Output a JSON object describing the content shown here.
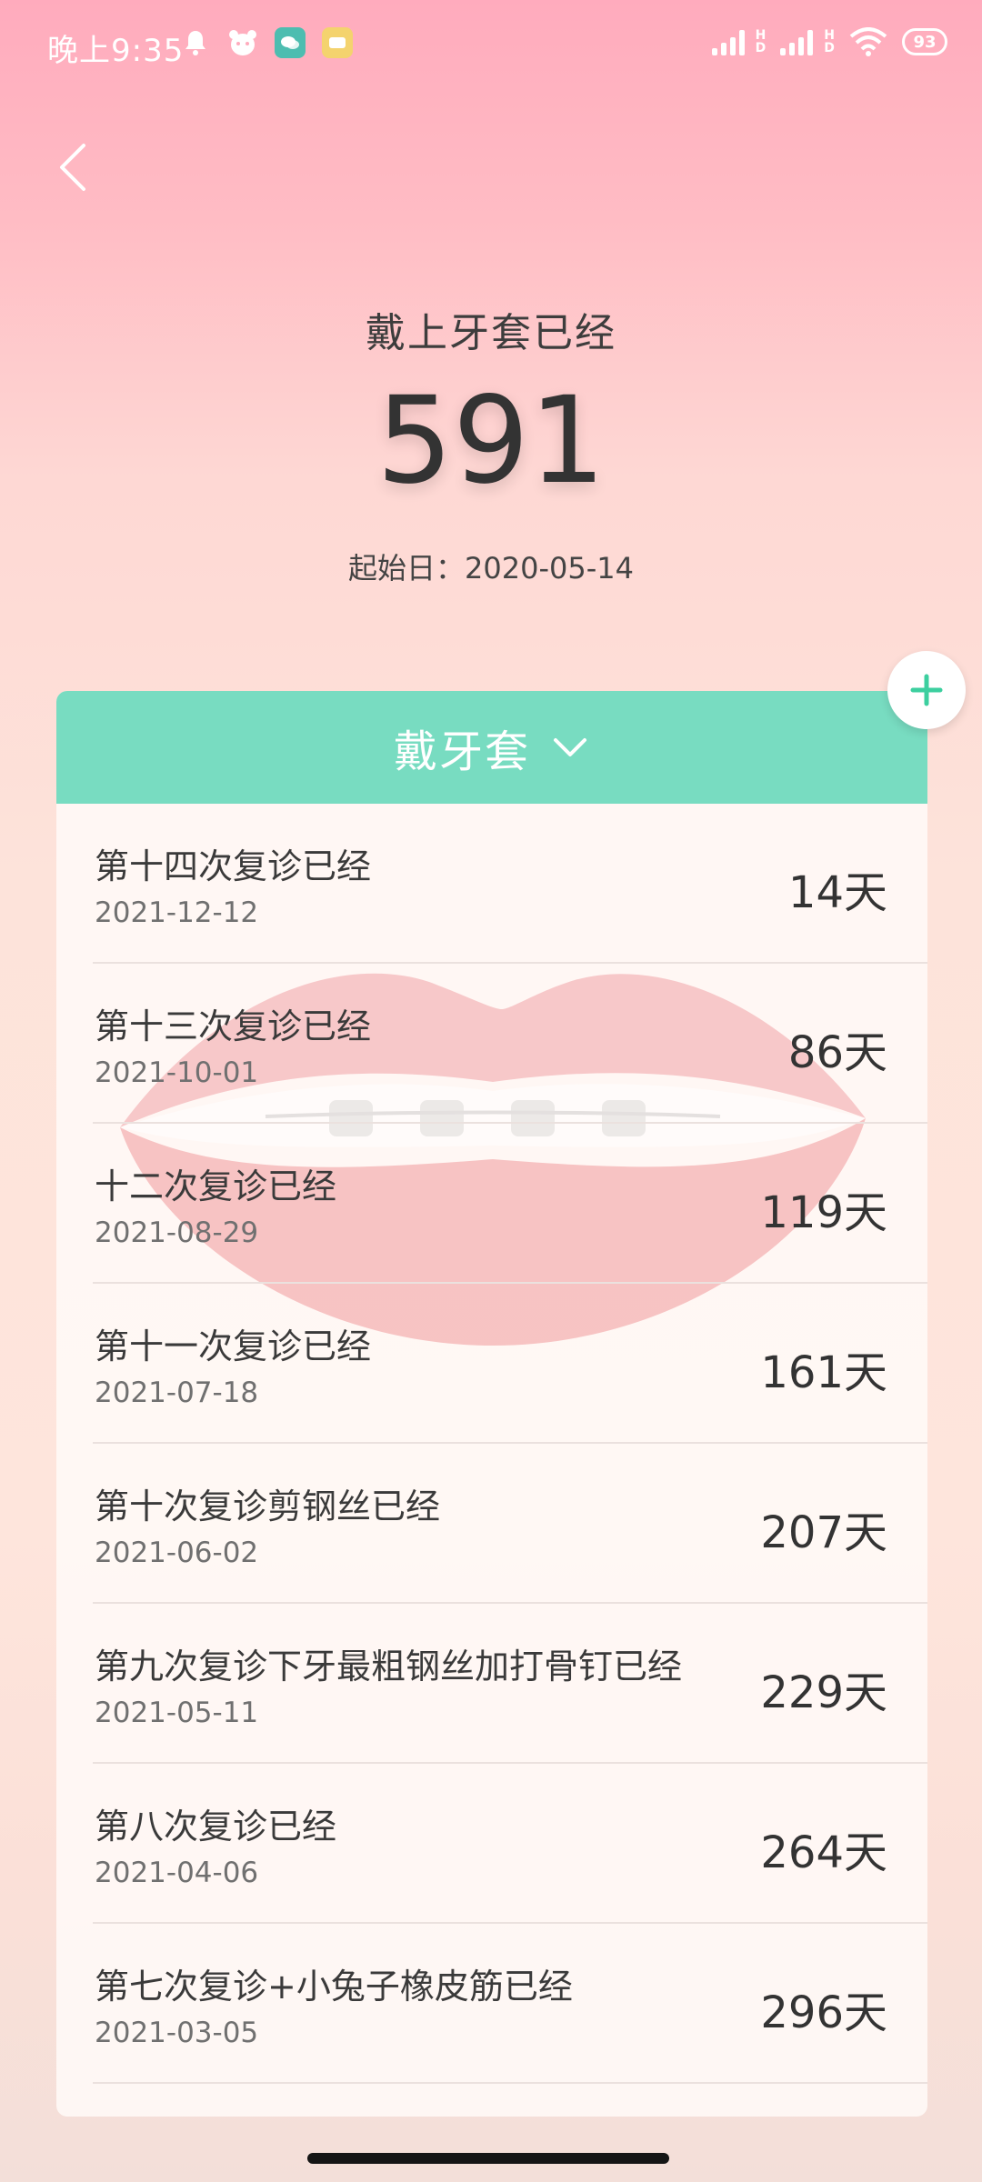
{
  "status_bar": {
    "time": "晚上9:35",
    "battery": "93",
    "icons": [
      "bell-icon",
      "bear-icon",
      "wechat-icon",
      "message-icon",
      "signal-icon",
      "signal-icon",
      "wifi-icon",
      "battery-icon"
    ]
  },
  "header": {
    "title": "戴上牙套已经",
    "days": "591",
    "start_date": "起始日：2020-05-14"
  },
  "card": {
    "category": "戴牙套",
    "accent_color": "#78dcc1",
    "items": [
      {
        "title": "第十四次复诊已经",
        "date": "2021-12-12",
        "days": "14天"
      },
      {
        "title": "第十三次复诊已经",
        "date": "2021-10-01",
        "days": "86天"
      },
      {
        "title": "十二次复诊已经",
        "date": "2021-08-29",
        "days": "119天"
      },
      {
        "title": "第十一次复诊已经",
        "date": "2021-07-18",
        "days": "161天"
      },
      {
        "title": "第十次复诊剪钢丝已经",
        "date": "2021-06-02",
        "days": "207天"
      },
      {
        "title": "第九次复诊下牙最粗钢丝加打骨钉已经",
        "date": "2021-05-11",
        "days": "229天"
      },
      {
        "title": "第八次复诊已经",
        "date": "2021-04-06",
        "days": "264天"
      },
      {
        "title": "第七次复诊+小兔子橡皮筋已经",
        "date": "2021-03-05",
        "days": "296天"
      }
    ]
  }
}
